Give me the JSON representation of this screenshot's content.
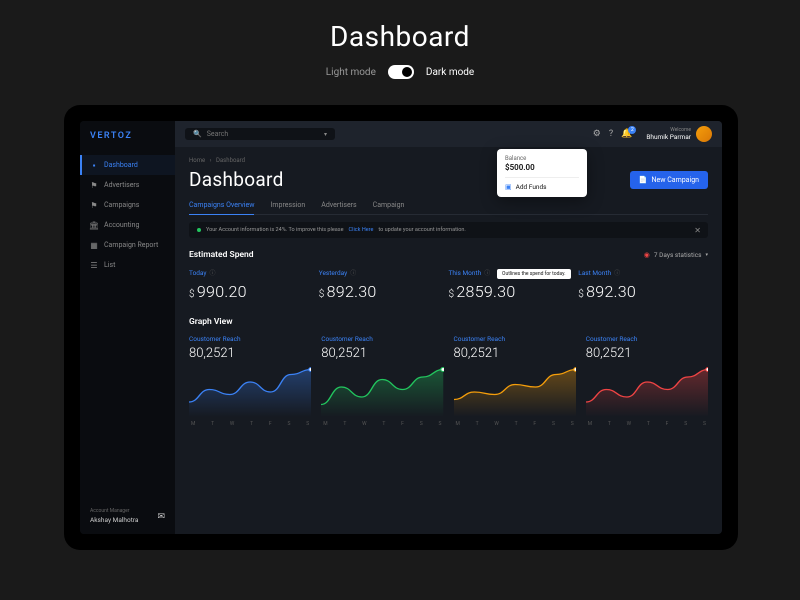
{
  "page_heading": "Dashboard",
  "mode": {
    "light": "Light mode",
    "dark": "Dark mode",
    "active": "dark"
  },
  "brand": "VERTOZ",
  "sidebar": {
    "items": [
      {
        "label": "Dashboard",
        "icon": "▪",
        "active": true
      },
      {
        "label": "Advertisers",
        "icon": "⚑",
        "active": false
      },
      {
        "label": "Campaigns",
        "icon": "⚑",
        "active": false
      },
      {
        "label": "Accounting",
        "icon": "🏛",
        "active": false
      },
      {
        "label": "Campaign Report",
        "icon": "▦",
        "active": false
      },
      {
        "label": "List",
        "icon": "☰",
        "active": false
      }
    ],
    "manager_label": "Account Manager",
    "manager_name": "Akshay Malhotra"
  },
  "topbar": {
    "search_placeholder": "Search",
    "notif_count": "2",
    "welcome": "Welcome",
    "user_name": "Bhumik Parmar"
  },
  "balance_popover": {
    "label": "Balance",
    "amount": "$500.00",
    "add_label": "Add Funds"
  },
  "breadcrumbs": {
    "home": "Home",
    "current": "Dashboard"
  },
  "main_title": "Dashboard",
  "new_campaign_label": "New Campaign",
  "tabs": [
    {
      "label": "Campaigns Overview",
      "active": true
    },
    {
      "label": "Impression",
      "active": false
    },
    {
      "label": "Advertisers",
      "active": false
    },
    {
      "label": "Campaign",
      "active": false
    }
  ],
  "banner": {
    "text_pre": "Your Account information is 24%. To improve this please ",
    "link": "Click Here",
    "text_post": " to update your account information."
  },
  "spend": {
    "title": "Estimated Spend",
    "selector": "7 Days statistics",
    "columns": [
      {
        "label": "Today",
        "amount": "990.20"
      },
      {
        "label": "Yesterday",
        "amount": "892.30"
      },
      {
        "label": "This Month",
        "amount": "2859.30"
      },
      {
        "label": "Last Month",
        "amount": "892.30"
      }
    ]
  },
  "tooltip_text": "Outlines the spend for today.",
  "graph": {
    "title": "Graph View",
    "label": "Coustomer Reach",
    "value": "80,2521",
    "days": [
      "M",
      "T",
      "W",
      "T",
      "F",
      "S",
      "S"
    ],
    "colors": [
      "#3b82f6",
      "#22c55e",
      "#f59e0b",
      "#ef4444"
    ]
  },
  "chart_data": [
    {
      "type": "area",
      "series_name": "Coustomer Reach",
      "color": "#3b82f6",
      "x": [
        "M",
        "T",
        "W",
        "T",
        "F",
        "S",
        "S"
      ],
      "values": [
        30,
        55,
        45,
        70,
        50,
        85,
        95
      ],
      "ylim": [
        0,
        100
      ]
    },
    {
      "type": "area",
      "series_name": "Coustomer Reach",
      "color": "#22c55e",
      "x": [
        "M",
        "T",
        "W",
        "T",
        "F",
        "S",
        "S"
      ],
      "values": [
        25,
        60,
        40,
        75,
        55,
        80,
        95
      ],
      "ylim": [
        0,
        100
      ]
    },
    {
      "type": "area",
      "series_name": "Coustomer Reach",
      "color": "#f59e0b",
      "x": [
        "M",
        "T",
        "W",
        "T",
        "F",
        "S",
        "S"
      ],
      "values": [
        35,
        50,
        45,
        65,
        60,
        85,
        95
      ],
      "ylim": [
        0,
        100
      ]
    },
    {
      "type": "area",
      "series_name": "Coustomer Reach",
      "color": "#ef4444",
      "x": [
        "M",
        "T",
        "W",
        "T",
        "F",
        "S",
        "S"
      ],
      "values": [
        30,
        55,
        40,
        70,
        55,
        80,
        95
      ],
      "ylim": [
        0,
        100
      ]
    }
  ]
}
